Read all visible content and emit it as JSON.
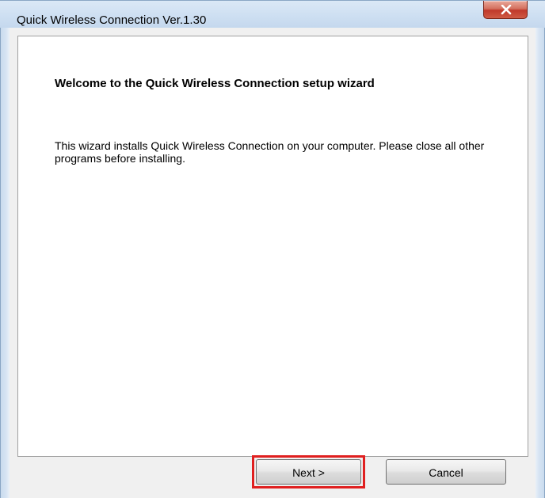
{
  "window": {
    "title": "Quick Wireless Connection Ver.1.30"
  },
  "wizard": {
    "heading": "Welcome to the Quick Wireless Connection setup wizard",
    "description": "This wizard installs Quick Wireless Connection on your computer. Please close all other programs before installing."
  },
  "buttons": {
    "next_label": "Next >",
    "cancel_label": "Cancel"
  },
  "icons": {
    "close": "close-icon"
  },
  "colors": {
    "highlight": "#e02020",
    "close_button": "#c0392b"
  }
}
